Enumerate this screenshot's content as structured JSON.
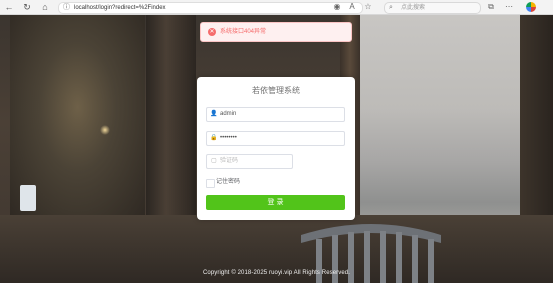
{
  "browser": {
    "url": "localhost/login?redirect=%2Findex",
    "search_placeholder": "点此搜索"
  },
  "toast": {
    "message": "系统接口404异常",
    "color": "#f56c6c"
  },
  "login": {
    "title": "若依管理系统",
    "username": "admin",
    "password_mask": "••••••••",
    "captcha_placeholder": "验证码",
    "remember_label": "记住密码",
    "submit_label": "登 录",
    "accent": "#52c41a"
  },
  "footer": {
    "copyright": "Copyright © 2018-2025 ruoyi.vip All Rights Reserved."
  }
}
